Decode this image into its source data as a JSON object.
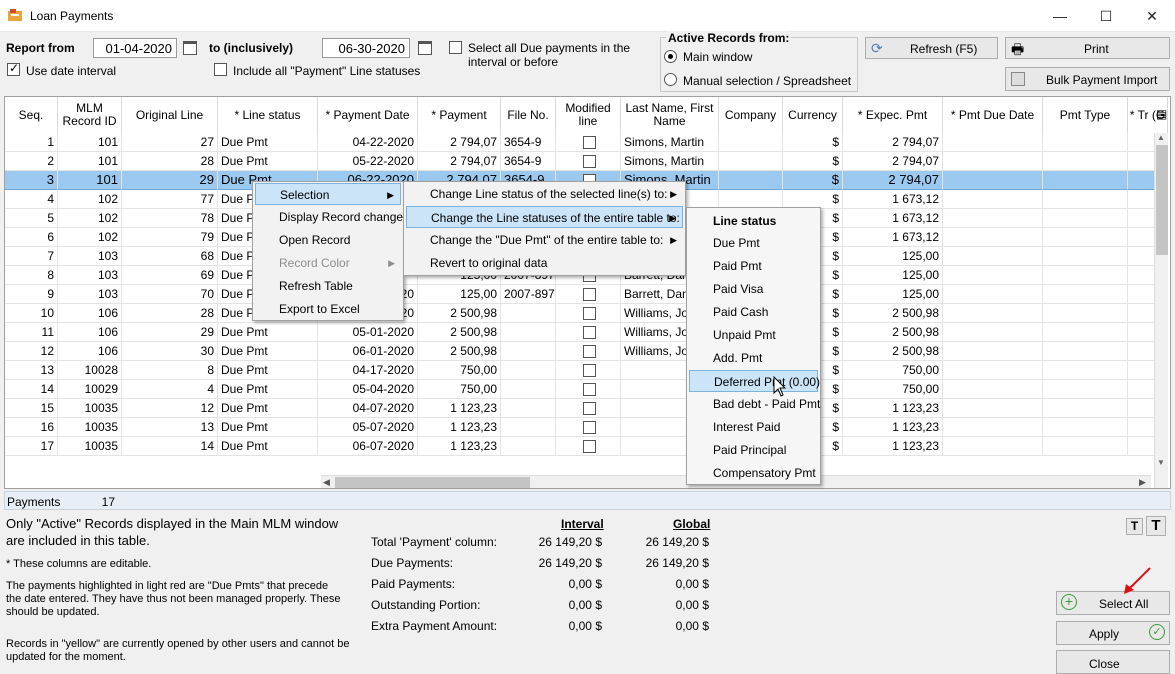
{
  "window": {
    "title": "Loan Payments",
    "minimize": "—",
    "maximize": "☐",
    "close": "✕"
  },
  "filters": {
    "report_from_label": "Report from",
    "date_from": "01-04-2020",
    "to_label": "to (inclusively)",
    "date_to": "06-30-2020",
    "select_all_due_label": "Select all Due payments in the interval or before",
    "use_date_interval_label": "Use date interval",
    "include_all_label": "Include all \"Payment\" Line statuses"
  },
  "active_records": {
    "title": "Active Records from:",
    "option_main": "Main window",
    "option_manual": "Manual selection / Spreadsheet"
  },
  "toolbar": {
    "refresh_label": "Refresh (F5)",
    "print_label": "Print",
    "bulk_import_label": "Bulk Payment Import"
  },
  "columns": {
    "seq": "Seq.",
    "mlm": "MLM Record ID",
    "orig": "Original Line",
    "status": "* Line status",
    "pdate": "* Payment Date",
    "payment": "* Payment",
    "file": "File No.",
    "modified": "Modified line",
    "name": "Last Name, First Name",
    "company": "Company",
    "currency": "Currency",
    "expec": "* Expec. Pmt",
    "due": "* Pmt Due Date",
    "ptype": "Pmt Type",
    "tr": "* Tr (G"
  },
  "rows": [
    {
      "seq": "1",
      "mlm": "101",
      "orig": "27",
      "status": "Due Pmt",
      "pdate": "04-22-2020",
      "payment": "2 794,07",
      "file": "3654-9",
      "name": "Simons, Martin",
      "currency": "$",
      "expec": "2 794,07"
    },
    {
      "seq": "2",
      "mlm": "101",
      "orig": "28",
      "status": "Due Pmt",
      "pdate": "05-22-2020",
      "payment": "2 794,07",
      "file": "3654-9",
      "name": "Simons, Martin",
      "currency": "$",
      "expec": "2 794,07"
    },
    {
      "seq": "3",
      "mlm": "101",
      "orig": "29",
      "status": "Due Pmt",
      "pdate": "06-22-2020",
      "payment": "2 794,07",
      "file": "3654-9",
      "name": "Simons, Martin",
      "currency": "$",
      "expec": "2 794,07"
    },
    {
      "seq": "4",
      "mlm": "102",
      "orig": "77",
      "status": "Due Pmt",
      "pdate": "",
      "payment": "",
      "file": "",
      "name": "",
      "currency": "$",
      "expec": "1 673,12"
    },
    {
      "seq": "5",
      "mlm": "102",
      "orig": "78",
      "status": "Due Pmt",
      "pdate": "",
      "payment": "",
      "file": "",
      "name": "",
      "currency": "$",
      "expec": "1 673,12"
    },
    {
      "seq": "6",
      "mlm": "102",
      "orig": "79",
      "status": "Due Pmt",
      "pdate": "",
      "payment": "",
      "file": "",
      "name": "",
      "currency": "$",
      "expec": "1 673,12"
    },
    {
      "seq": "7",
      "mlm": "103",
      "orig": "68",
      "status": "Due Pmt",
      "pdate": "",
      "payment": "",
      "file": "",
      "name": "",
      "currency": "$",
      "expec": "125,00"
    },
    {
      "seq": "8",
      "mlm": "103",
      "orig": "69",
      "status": "Due Pmt",
      "pdate": "",
      "payment": "125,00",
      "file": "2007-897",
      "name": "Barrett, Danie",
      "currency": "$",
      "expec": "125,00"
    },
    {
      "seq": "9",
      "mlm": "103",
      "orig": "70",
      "status": "Due Pmt",
      "pdate": "06-12-2020",
      "payment": "125,00",
      "file": "2007-897",
      "name": "Barrett, Danie",
      "currency": "$",
      "expec": "125,00"
    },
    {
      "seq": "10",
      "mlm": "106",
      "orig": "28",
      "status": "Due Pmt",
      "pdate": "04-01-2020",
      "payment": "2 500,98",
      "file": "",
      "name": "Williams, John",
      "currency": "$",
      "expec": "2 500,98"
    },
    {
      "seq": "11",
      "mlm": "106",
      "orig": "29",
      "status": "Due Pmt",
      "pdate": "05-01-2020",
      "payment": "2 500,98",
      "file": "",
      "name": "Williams, John",
      "currency": "$",
      "expec": "2 500,98"
    },
    {
      "seq": "12",
      "mlm": "106",
      "orig": "30",
      "status": "Due Pmt",
      "pdate": "06-01-2020",
      "payment": "2 500,98",
      "file": "",
      "name": "Williams, John",
      "currency": "$",
      "expec": "2 500,98"
    },
    {
      "seq": "13",
      "mlm": "10028",
      "orig": "8",
      "status": "Due Pmt",
      "pdate": "04-17-2020",
      "payment": "750,00",
      "file": "",
      "name": "",
      "currency": "$",
      "expec": "750,00"
    },
    {
      "seq": "14",
      "mlm": "10029",
      "orig": "4",
      "status": "Due Pmt",
      "pdate": "05-04-2020",
      "payment": "750,00",
      "file": "",
      "name": "",
      "currency": "$",
      "expec": "750,00"
    },
    {
      "seq": "15",
      "mlm": "10035",
      "orig": "12",
      "status": "Due Pmt",
      "pdate": "04-07-2020",
      "payment": "1 123,23",
      "file": "",
      "name": "",
      "currency": "$",
      "expec": "1 123,23"
    },
    {
      "seq": "16",
      "mlm": "10035",
      "orig": "13",
      "status": "Due Pmt",
      "pdate": "05-07-2020",
      "payment": "1 123,23",
      "file": "",
      "name": "",
      "currency": "$",
      "expec": "1 123,23"
    },
    {
      "seq": "17",
      "mlm": "10035",
      "orig": "14",
      "status": "Due Pmt",
      "pdate": "06-07-2020",
      "payment": "1 123,23",
      "file": "",
      "name": "",
      "currency": "$",
      "expec": "1 123,23"
    }
  ],
  "footer": {
    "payments_label": "Payments",
    "payments_count": "17"
  },
  "context_menu": {
    "items": [
      "Selection",
      "Display Record changes",
      "Open Record",
      "Record Color",
      "Refresh Table",
      "Export to Excel"
    ]
  },
  "submenu": {
    "items": [
      "Change Line status of the selected line(s) to:",
      "Change the Line statuses of the entire table to:",
      "Change the \"Due Pmt\" of the entire table to:",
      "Revert to original data"
    ]
  },
  "status_menu": {
    "header": "Line status",
    "items": [
      "Due Pmt",
      "Paid Pmt",
      "Paid Visa",
      "Paid Cash",
      "Unpaid Pmt",
      "Add. Pmt",
      "Deferred Pmt (0.00)",
      "Bad debt - Paid Pmt",
      "Interest Paid",
      "Paid Principal",
      "Compensatory Pmt"
    ]
  },
  "notes": {
    "active_only": "Only \"Active\" Records displayed in the Main MLM window are included in this table.",
    "editable": "* These columns are editable.",
    "red": "The payments highlighted in light red are \"Due Pmts\" that precede the date entered. They have thus not been managed properly. These should be updated.",
    "yellow": "Records in \"yellow\" are currently opened by other users and cannot be updated for the moment."
  },
  "summary": {
    "interval_label": "Interval",
    "global_label": "Global",
    "rows": [
      {
        "label": "Total 'Payment' column:",
        "interval": "26 149,20 $",
        "global": "26 149,20 $"
      },
      {
        "label": "Due Payments:",
        "interval": "26 149,20 $",
        "global": "26 149,20 $"
      },
      {
        "label": "Paid Payments:",
        "interval": "0,00 $",
        "global": "0,00 $"
      },
      {
        "label": "Outstanding Portion:",
        "interval": "0,00 $",
        "global": "0,00 $"
      },
      {
        "label": "Extra Payment Amount:",
        "interval": "0,00 $",
        "global": "0,00 $"
      }
    ]
  },
  "actions": {
    "select_all": "Select All",
    "apply": "Apply",
    "close": "Close",
    "font_small": "T",
    "font_large": "T"
  }
}
